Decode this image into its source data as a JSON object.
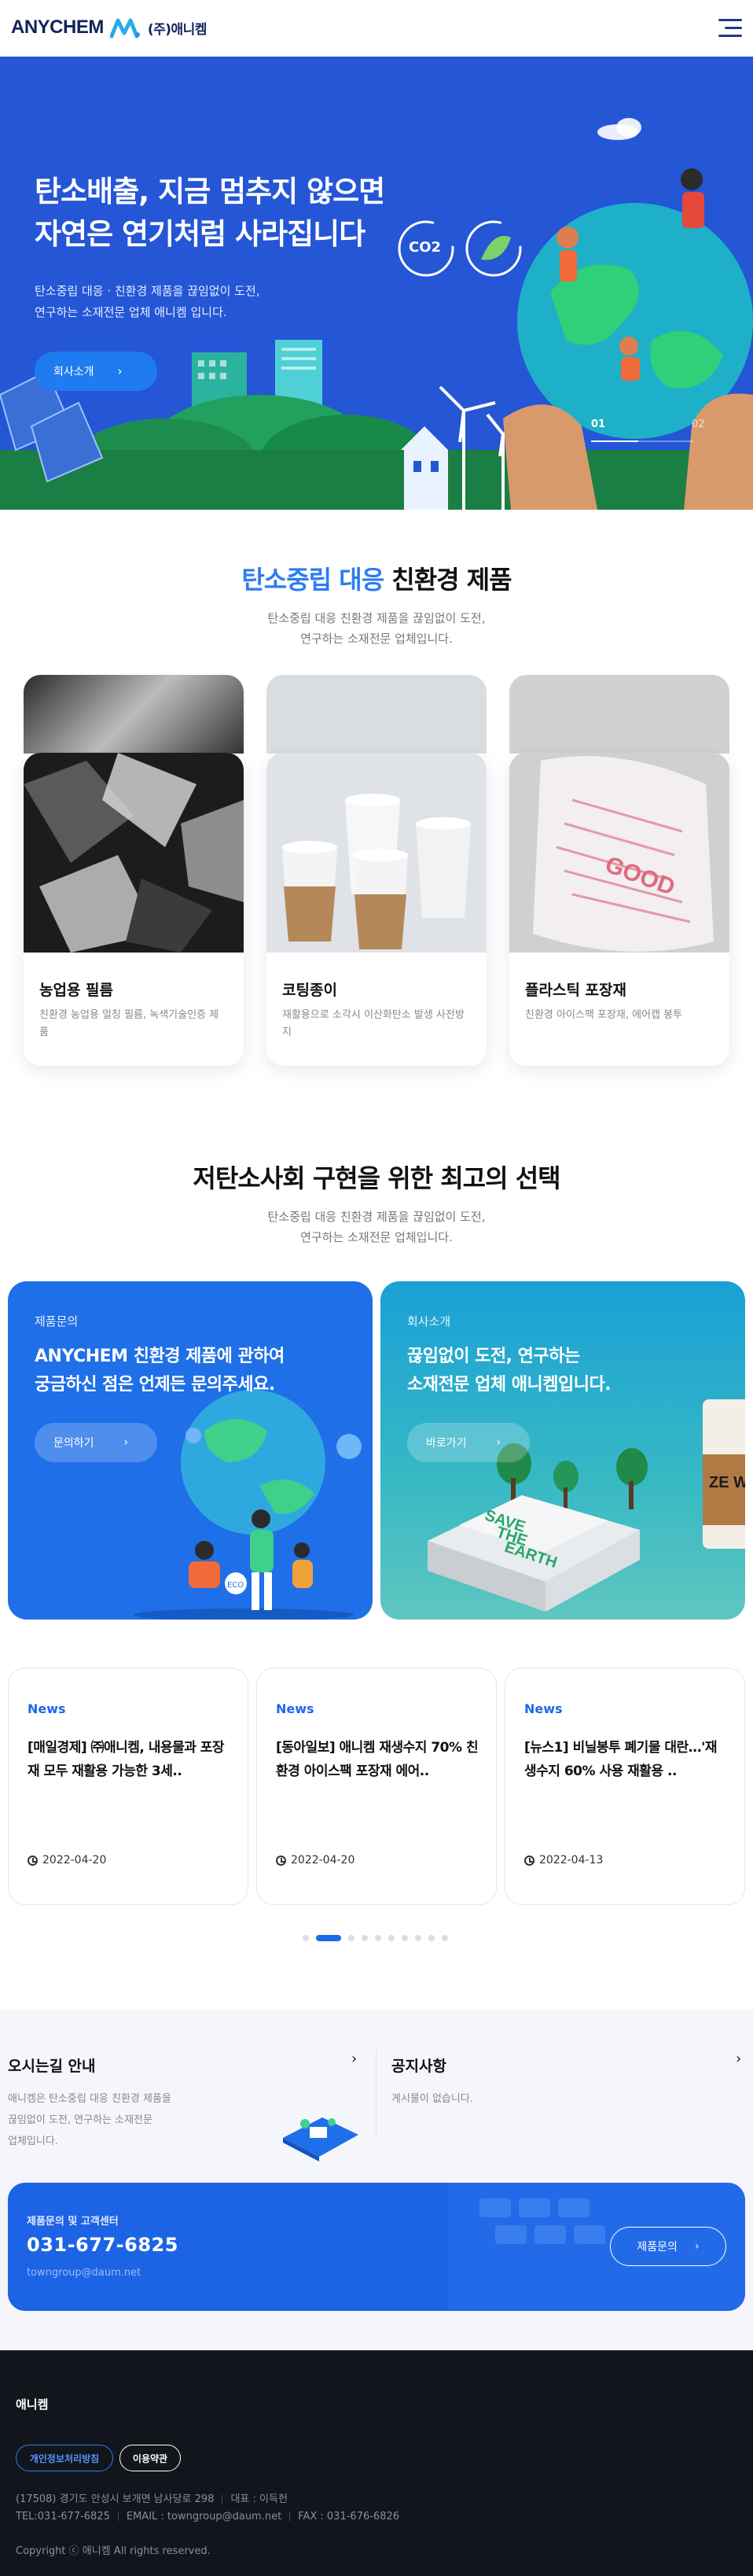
{
  "header": {
    "logo_en": "ANYCHEM",
    "logo_ko": "(주)애니켐",
    "menu_icon": "hamburger-menu-icon"
  },
  "hero": {
    "title_line1": "탄소배출, 지금 멈추지 않으면",
    "title_line2": "자연은 연기처럼 사라집니다",
    "sub_line1": "탄소중립 대응 · 친환경 제품을 끊임없이 도전,",
    "sub_line2": "연구하는 소재전문 업체 애니켐 입니다.",
    "button_label": "회사소개",
    "slide_current": "01",
    "slide_total": "02",
    "co2_label": "CO2"
  },
  "products_section": {
    "title_highlight": "탄소중립 대응",
    "title_rest": " 친환경 제품",
    "sub_line1": "탄소중립 대응 친환경 제품을 끊임없이 도전,",
    "sub_line2": "연구하는 소재전문 업체입니다.",
    "items": [
      {
        "name": "농업용 필름",
        "desc": "친환경 농업용 멀칭 필름, 녹색기술인증 제품"
      },
      {
        "name": "코팅종이",
        "desc": "재활용으로 소각시 이산화탄소 발생 사전방지"
      },
      {
        "name": "플라스틱 포장재",
        "desc": "친환경 아이스팩 포장재, 에어캡 봉투"
      }
    ]
  },
  "choice_section": {
    "title": "저탄소사회 구현을 위한 최고의 선택",
    "sub_line1": "탄소중립 대응 친환경 제품을 끊임없이 도전,",
    "sub_line2": "연구하는 소재전문 업체입니다.",
    "banners": [
      {
        "tag": "제품문의",
        "title_line1": "ANYCHEM 친환경 제품에 관하여",
        "title_line2": "궁금하신 점은 언제든 문의주세요.",
        "button": "문의하기",
        "color": "#1f6fe8"
      },
      {
        "tag": "회사소개",
        "title_line1": "끊임없이 도전, 연구하는",
        "title_line2": "소재전문 업체 애니켐입니다.",
        "button": "바로가기",
        "color": "#1fa6c9"
      }
    ],
    "art_text": {
      "eco": "ECO",
      "save": "SAVE",
      "the": "THE",
      "earth": "EARTH",
      "cup": "ZE WA"
    }
  },
  "news": {
    "items": [
      {
        "tag": "News",
        "title": "[매일경제] ㈜애니켐, 내용물과 포장재 모두 재활용 가능한 3세..",
        "date": "2022-04-20"
      },
      {
        "tag": "News",
        "title": "[동아일보] 애니켐 재생수지 70% 친환경 아이스팩 포장재 에어..",
        "date": "2022-04-20"
      },
      {
        "tag": "News",
        "title": "[뉴스1] 비닐봉투 폐기물 대란…'재생수지 60% 사용 재활용 ..",
        "date": "2022-04-13"
      }
    ],
    "page_count": 10,
    "active_page": 2
  },
  "info": {
    "directions_title": "오시는길 안내",
    "directions_text_line1": "애니켐은 탄소중립 대응 친환경 제품을",
    "directions_text_line2": "끊임없이 도전, 연구하는 소재전문",
    "directions_text_line3": "업체입니다.",
    "notice_title": "공지사항",
    "notice_text": "게시물이 없습니다.",
    "arrow": "›"
  },
  "customer_center": {
    "label": "제품문의 및 고객센터",
    "phone": "031-677-6825",
    "email": "towngroup@daum.net",
    "button": "제품문의"
  },
  "footer": {
    "company": "애니켐",
    "privacy_button": "개인정보처리방침",
    "terms_button": "이용약관",
    "address": "(17508) 경기도 안성시 보개면 남사당로 298",
    "ceo": "대표 : 이득헌",
    "tel": "TEL:031-677-6825",
    "email": "EMAIL : towngroup@daum.net",
    "fax": "FAX : 031-676-6826",
    "copyright": "Copyright ⓒ 애니켐 All rights reserved."
  },
  "colors": {
    "primary": "#1f6fe8",
    "navy": "#12235c",
    "hero_bg": "#2456d6",
    "footer_bg": "#12151c"
  }
}
